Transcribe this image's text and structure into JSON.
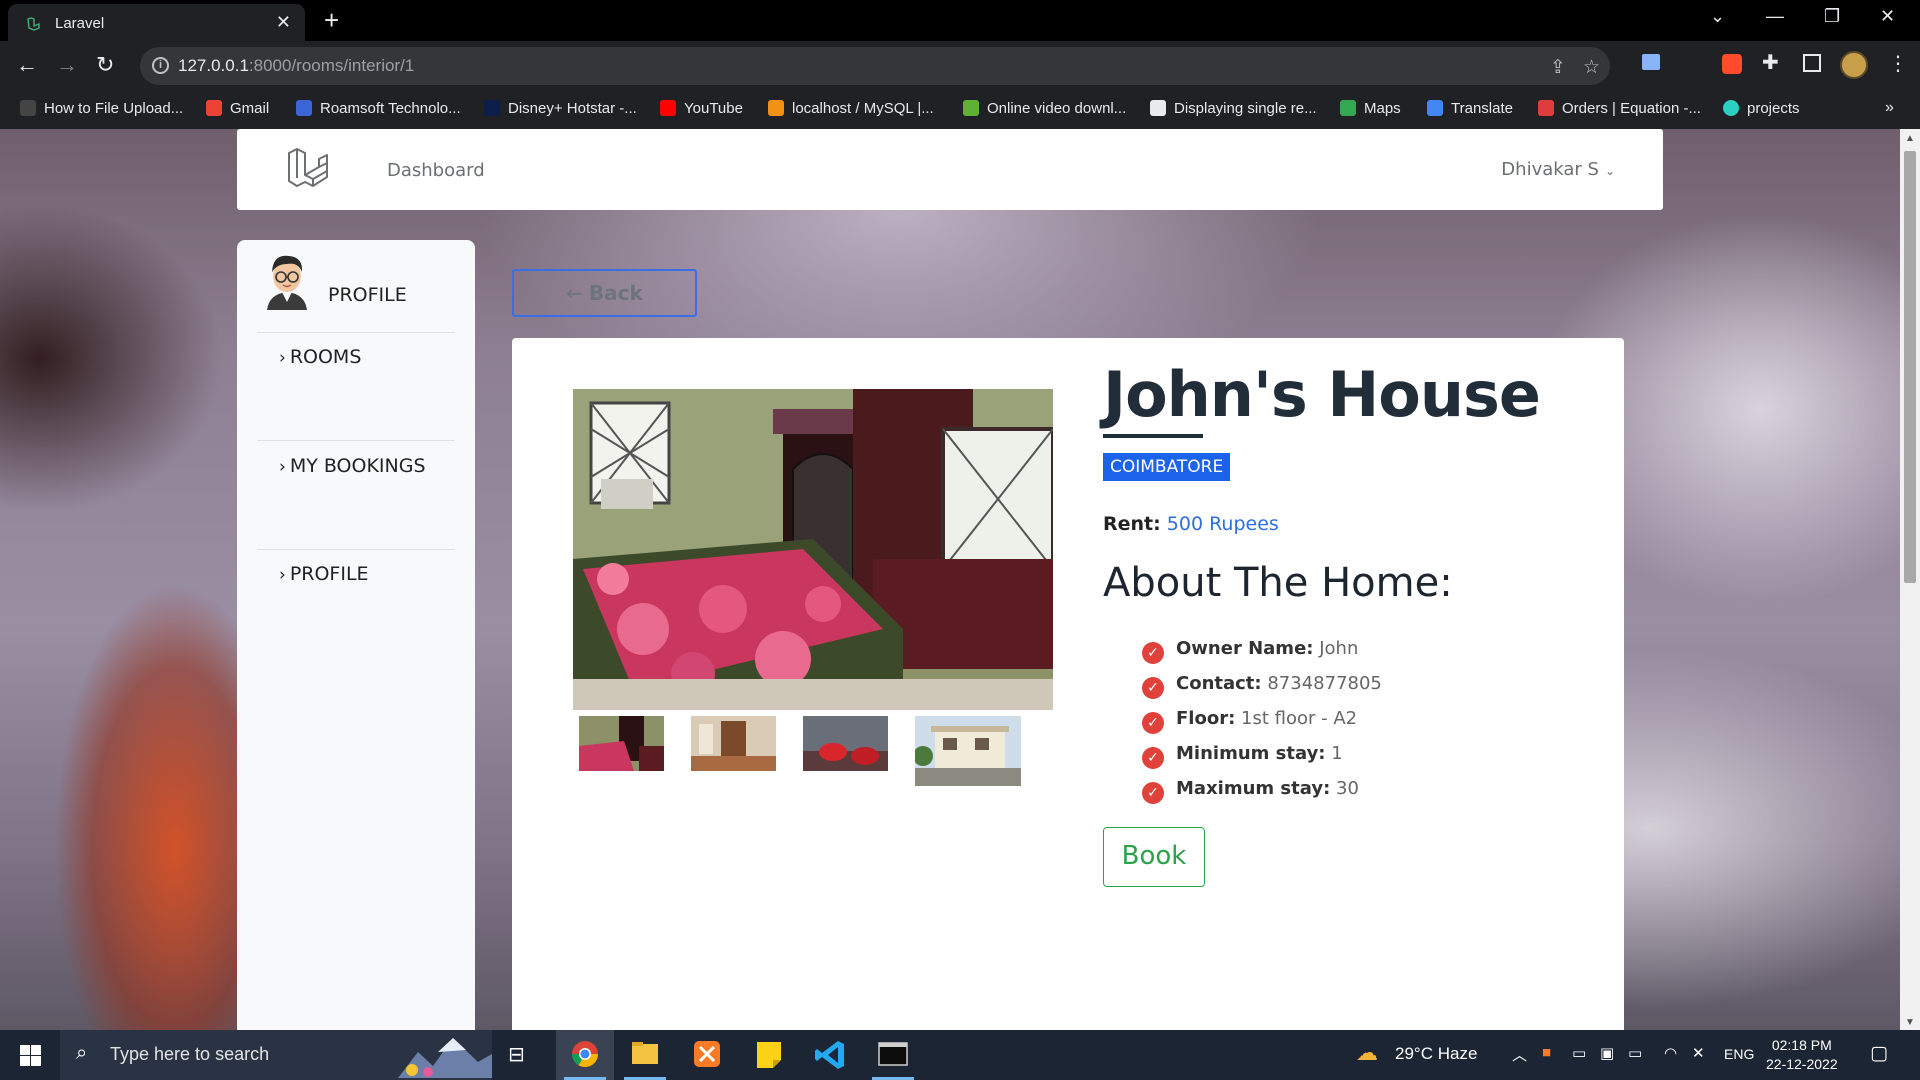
{
  "browser": {
    "tab_title": "Laravel",
    "url_host": "127.0.0.1",
    "url_path": ":8000/rooms/interior/1",
    "bookmarks": [
      {
        "label": "How to File Upload...",
        "icon": "bookmark-icon"
      },
      {
        "label": "Gmail",
        "icon": "gmail-icon"
      },
      {
        "label": "Roamsoft Technolo...",
        "icon": "roamsoft-icon"
      },
      {
        "label": "Disney+ Hotstar -...",
        "icon": "hotstar-icon"
      },
      {
        "label": "YouTube",
        "icon": "youtube-icon"
      },
      {
        "label": "localhost / MySQL |...",
        "icon": "phpmyadmin-icon"
      },
      {
        "label": "Online video downl...",
        "icon": "download-icon"
      },
      {
        "label": "Displaying single re...",
        "icon": "w3schools-icon"
      },
      {
        "label": "Maps",
        "icon": "maps-icon"
      },
      {
        "label": "Translate",
        "icon": "translate-icon"
      },
      {
        "label": "Orders | Equation -...",
        "icon": "equation-icon"
      },
      {
        "label": "projects",
        "icon": "projects-icon"
      }
    ],
    "more_bookmarks": "»"
  },
  "navbar": {
    "dashboard": "Dashboard",
    "user": "Dhivakar S"
  },
  "sidebar": {
    "profile_header": "PROFILE",
    "items": [
      {
        "label": "ROOMS"
      },
      {
        "label": "MY BOOKINGS"
      },
      {
        "label": "PROFILE"
      }
    ]
  },
  "back_label": "Back",
  "house": {
    "title": "John's House",
    "city": "COIMBATORE",
    "rent_label": "Rent:",
    "rent_value": "500 Rupees",
    "about_heading": "About The Home:",
    "details": [
      {
        "label": "Owner Name:",
        "value": "John"
      },
      {
        "label": "Contact:",
        "value": "8734877805"
      },
      {
        "label": "Floor:",
        "value": "1st floor - A2"
      },
      {
        "label": "Minimum stay:",
        "value": "1"
      },
      {
        "label": "Maximum stay:",
        "value": "30"
      }
    ],
    "book_label": "Book"
  },
  "taskbar": {
    "search_placeholder": "Type here to search",
    "weather": "29°C  Haze",
    "lang": "ENG",
    "time": "02:18 PM",
    "date": "22-12-2022"
  },
  "colors": {
    "accent_blue": "#1b63e8",
    "book_green": "#2ea24a",
    "check_red": "#e0413a"
  }
}
